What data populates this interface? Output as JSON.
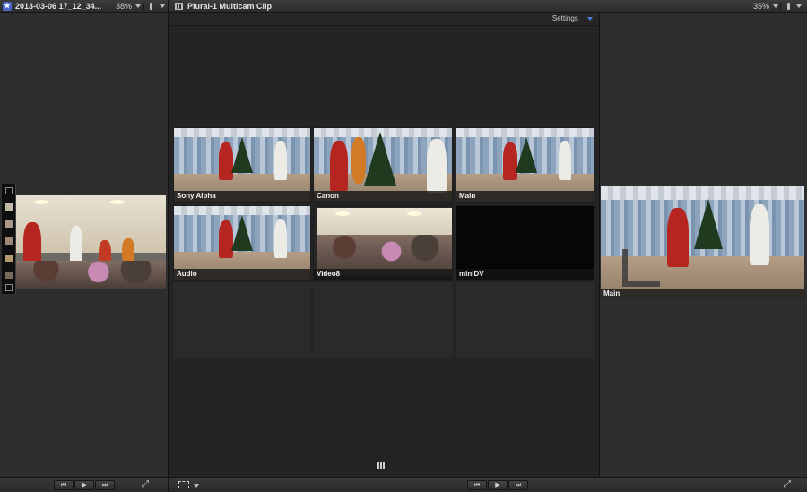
{
  "left_viewer": {
    "title": "2013-03-06 17_12_34...",
    "zoom": "38%"
  },
  "angle_editor": {
    "title": "Plural-1 Multicam Clip",
    "settings_label": "Settings",
    "angles": [
      {
        "label": "Sony Alpha"
      },
      {
        "label": "Canon"
      },
      {
        "label": "Main"
      },
      {
        "label": "Audio"
      },
      {
        "label": "Video8"
      },
      {
        "label": "miniDV"
      }
    ]
  },
  "right_viewer": {
    "zoom": "35%",
    "active_angle": "Main"
  },
  "icons": {
    "app": "star-icon",
    "clip": "filmstrip-icon",
    "layout": "grid-icon"
  },
  "colors": {
    "background": "#2b2b2b",
    "panel": "#2e2e2e",
    "label_bar": "#141414"
  }
}
